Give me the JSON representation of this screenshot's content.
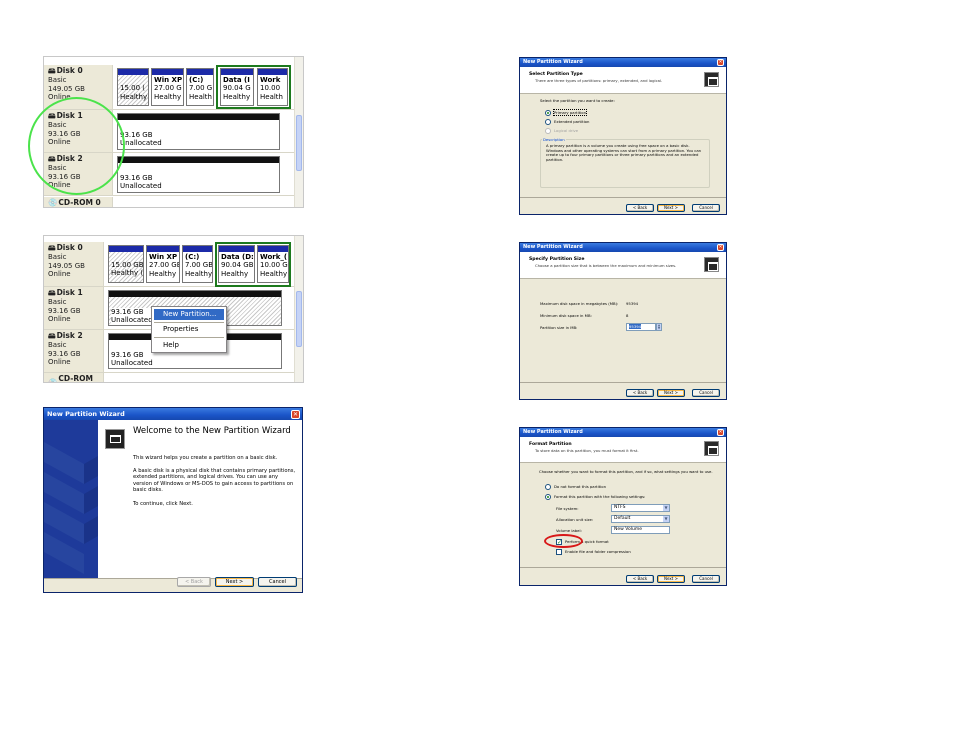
{
  "dm1": {
    "disks": [
      {
        "name": "Disk 0",
        "type": "Basic",
        "size": "149.05 GB",
        "status": "Online"
      },
      {
        "name": "Disk 1",
        "type": "Basic",
        "size": "93.16 GB",
        "status": "Online"
      },
      {
        "name": "Disk 2",
        "type": "Basic",
        "size": "93.16 GB",
        "status": "Online"
      },
      {
        "name": "CD-ROM 0"
      }
    ],
    "partitions": [
      {
        "name": "",
        "size": "15.00 (",
        "status": "Healthy"
      },
      {
        "name": "Win XP",
        "size": "27.00 G",
        "status": "Healthy"
      },
      {
        "name": "(C:)",
        "size": "7.00 G",
        "status": "Health"
      },
      {
        "name": "Data (I",
        "size": "90.04 G",
        "status": "Healthy"
      },
      {
        "name": "Work",
        "size": "10.00",
        "status": "Health"
      }
    ],
    "unalloc1": {
      "size": "93.16 GB",
      "label": "Unallocated"
    },
    "unalloc2": {
      "size": "93.16 GB",
      "label": "Unallocated"
    }
  },
  "dm2": {
    "disks": [
      {
        "name": "Disk 0",
        "type": "Basic",
        "size": "149.05 GB",
        "status": "Online"
      },
      {
        "name": "Disk 1",
        "type": "Basic",
        "size": "93.16 GB",
        "status": "Online"
      },
      {
        "name": "Disk 2",
        "type": "Basic",
        "size": "93.16 GB",
        "status": "Online"
      },
      {
        "name": "CD-ROM 0"
      }
    ],
    "partitions": [
      {
        "name": "",
        "size": "15.00 GB",
        "status": "Healthy ("
      },
      {
        "name": "Win XP P",
        "size": "27.00 GB",
        "status": "Healthy (I"
      },
      {
        "name": "(C:)",
        "size": "7.00 GB",
        "status": "Healthy"
      },
      {
        "name": "Data (D:",
        "size": "90.04 GB f",
        "status": "Healthy"
      },
      {
        "name": "Work_(",
        "size": "10.00 G",
        "status": "Healthy"
      }
    ],
    "unalloc1": {
      "size": "93.16 GB",
      "label": "Unallocated"
    },
    "unalloc2": {
      "size": "93.16 GB",
      "label": "Unallocated"
    },
    "context_menu": [
      "New Partition...",
      "Properties",
      "Help"
    ]
  },
  "welcome": {
    "title": "New Partition Wizard",
    "heading": "Welcome to the New Partition Wizard",
    "p1": "This wizard helps you create a partition on a basic disk.",
    "p2": "A basic disk is a physical disk that contains primary partitions, extended partitions, and logical drives. You can use any version of Windows or MS-DOS to gain access to partitions on basic disks.",
    "p3": "To continue, click Next.",
    "back": "< Back",
    "next": "Next >",
    "cancel": "Cancel"
  },
  "ptype": {
    "title": "New Partition Wizard",
    "header_title": "Select Partition Type",
    "header_sub": "There are three types of partitions: primary, extended, and logical.",
    "prompt": "Select the partition you want to create:",
    "options": [
      "Primary partition",
      "Extended partition",
      "Logical drive"
    ],
    "desc_label": "Description",
    "desc": "A primary partition is a volume you create using free space on a basic disk. Windows and other operating systems can start from a primary partition. You can create up to four primary partitions or three primary partitions and an extended partition.",
    "back": "< Back",
    "next": "Next >",
    "cancel": "Cancel"
  },
  "psize": {
    "title": "New Partition Wizard",
    "header_title": "Specify Partition Size",
    "header_sub": "Choose a partition size that is between the maximum and minimum sizes.",
    "max_label": "Maximum disk space in megabytes (MB):",
    "max_value": "95394",
    "min_label": "Minimum disk space in MB:",
    "min_value": "8",
    "size_label": "Partition size in MB:",
    "size_value": "95394",
    "back": "< Back",
    "next": "Next >",
    "cancel": "Cancel"
  },
  "pformat": {
    "title": "New Partition Wizard",
    "header_title": "Format Partition",
    "header_sub": "To store data on this partition, you must format it first.",
    "prompt": "Choose whether you want to format this partition, and if so, what settings you want to use.",
    "opt_no": "Do not format this partition",
    "opt_yes": "Format this partition with the following settings:",
    "fs_label": "File system:",
    "fs_value": "NTFS",
    "au_label": "Allocation unit size:",
    "au_value": "Default",
    "vl_label": "Volume label:",
    "vl_value": "New Volume",
    "quick": "Perform a quick format",
    "compress": "Enable file and folder compression",
    "back": "< Back",
    "next": "Next >",
    "cancel": "Cancel"
  },
  "colors": {
    "accent": "#1c2aa8",
    "highlight_green": "#1d7a1d",
    "circle_green": "#4be34b",
    "circle_red": "#d81818"
  }
}
